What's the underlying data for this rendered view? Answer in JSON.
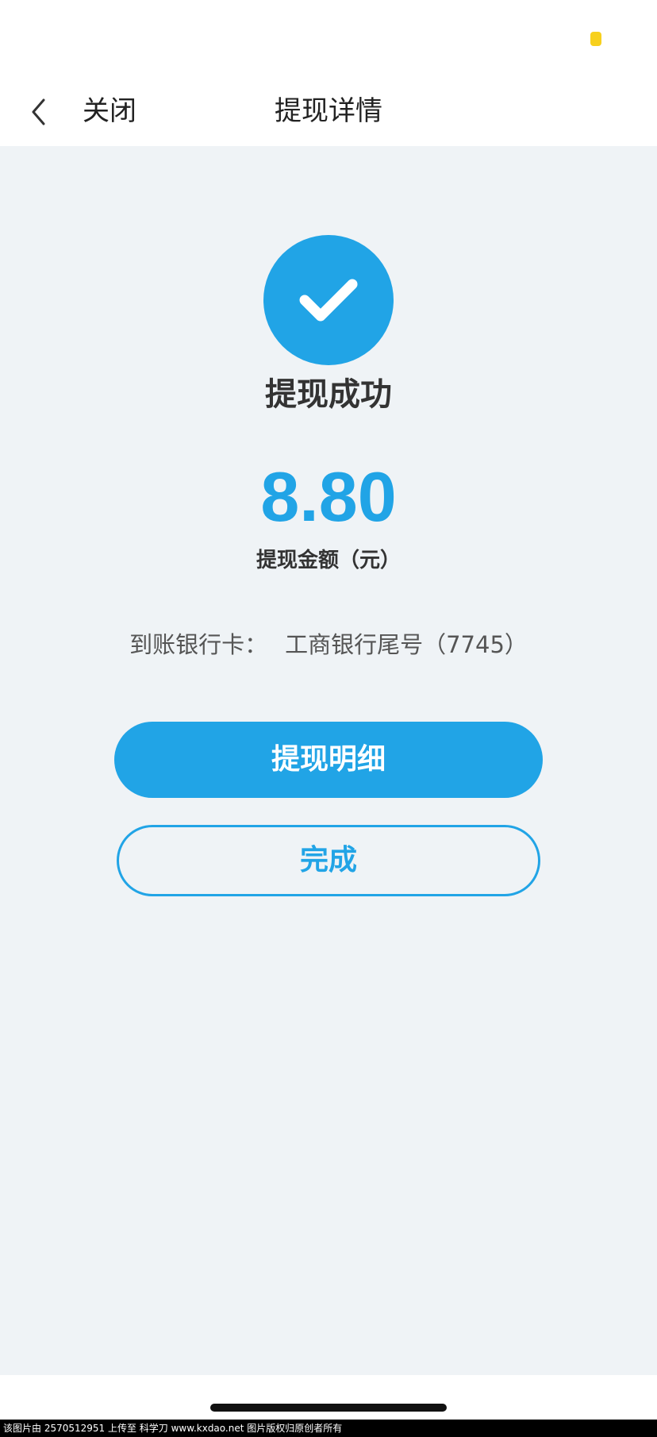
{
  "nav": {
    "close_label": "关闭",
    "title": "提现详情"
  },
  "result": {
    "status_text": "提现成功",
    "amount": "8.80",
    "amount_label": "提现金额（元）"
  },
  "bank": {
    "label": "到账银行卡：",
    "value": "工商银行尾号（7745）"
  },
  "actions": {
    "details_label": "提现明细",
    "done_label": "完成"
  },
  "watermark": {
    "text": "该图片由 2570512951 上传至 科学刀 www.kxdao.net 图片版权归原创者所有"
  },
  "colors": {
    "accent": "#21a4e6",
    "background": "#eff3f6",
    "status_dot": "#f7d01d"
  },
  "icons": {
    "back": "chevron-left-icon",
    "success": "checkmark-icon"
  }
}
